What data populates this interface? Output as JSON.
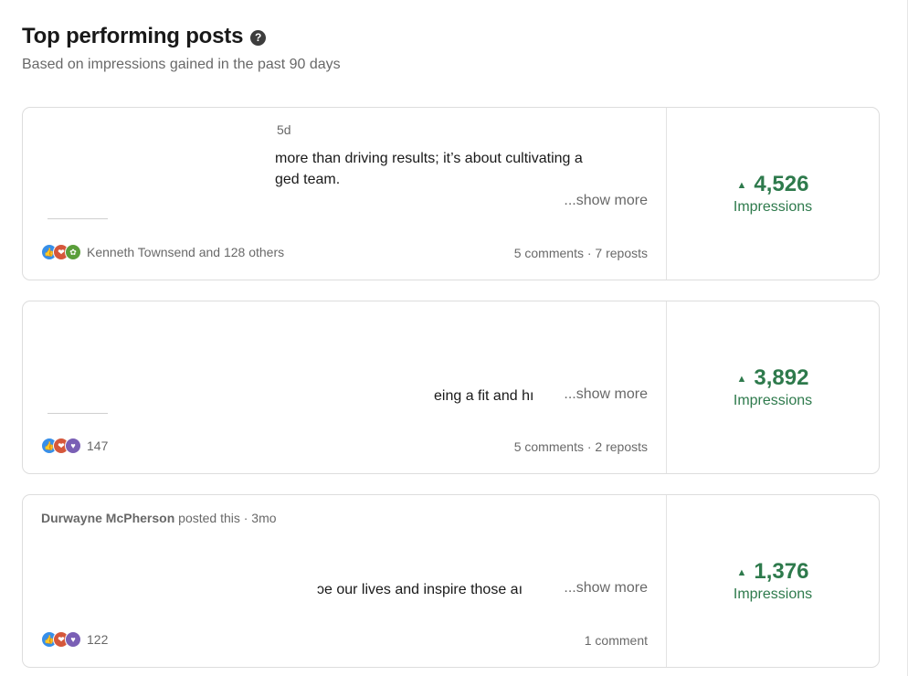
{
  "header": {
    "title": "Top performing posts",
    "subtitle": "Based on impressions gained in the past 90 days"
  },
  "posts": [
    {
      "time": "5d",
      "text_line1": "more than driving results; it’s about cultivating a",
      "text_line2": "ged team.",
      "show_more": "...show more",
      "reactions_label": "Kenneth Townsend and 128 others",
      "engagement": "5 comments · 7 reposts",
      "impressions_value": "4,526",
      "impressions_label": "Impressions"
    },
    {
      "text_line1": "eing a fit and hı",
      "show_more": "...show more",
      "reactions_label": "147",
      "engagement": "5 comments · 2 reposts",
      "impressions_value": "3,892",
      "impressions_label": "Impressions"
    },
    {
      "author": "Durwayne McPherson",
      "author_suffix": "posted this · 3mo",
      "text_line1": "ɔe our lives and inspire those aı",
      "show_more": "...show more",
      "reactions_label": "122",
      "engagement": "1 comment",
      "impressions_value": "1,376",
      "impressions_label": "Impressions"
    }
  ],
  "icons": {
    "help": "question-circle-icon",
    "trend": "triangle-up-icon",
    "reactions": [
      "like-icon",
      "celebrate-icon",
      "support-icon",
      "love-icon"
    ]
  },
  "colors": {
    "impressions_green": "#2e7a4c",
    "like_blue": "#378fe9",
    "celebrate_orange": "#d5573b"
  }
}
